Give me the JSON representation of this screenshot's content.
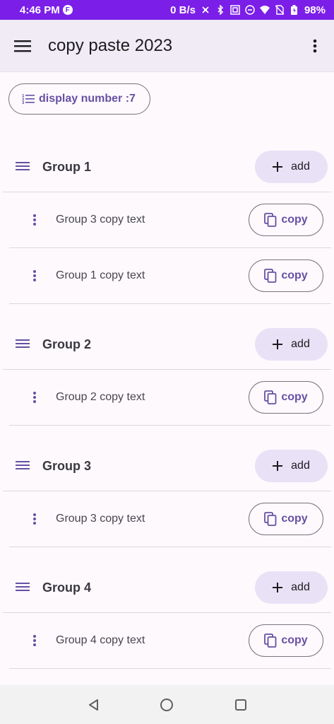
{
  "status_bar": {
    "time": "4:46 PM",
    "app_badge": "F",
    "net_speed": "0 B/s",
    "battery": "98%"
  },
  "app_bar": {
    "title": "copy paste 2023"
  },
  "display_chip": {
    "label": "display number :7"
  },
  "add_label": "add",
  "copy_label": "copy",
  "groups": [
    {
      "title": "Group 1",
      "items": [
        "Group 3 copy text",
        "Group 1 copy text"
      ]
    },
    {
      "title": "Group 2",
      "items": [
        "Group 2 copy text"
      ]
    },
    {
      "title": "Group 3",
      "items": [
        "Group 3 copy text"
      ]
    },
    {
      "title": "Group 4",
      "items": [
        "Group 4 copy text"
      ]
    }
  ],
  "colors": {
    "status_bar": "#7b1fe8",
    "accent": "#6750a4",
    "add_button_bg": "#e9e1f6",
    "app_bar_bg": "#f0ebf5"
  }
}
